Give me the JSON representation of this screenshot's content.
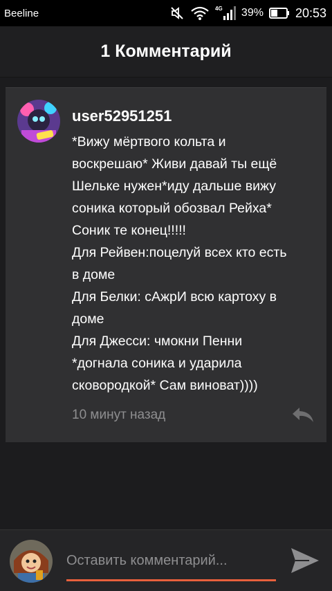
{
  "status_bar": {
    "carrier": "Beeline",
    "network": "4G",
    "battery_percent": "39%",
    "time": "20:53"
  },
  "header": {
    "title": "1 Комментарий"
  },
  "comment": {
    "username": "user52951251",
    "lines": [
      "*Вижу мёртвого кольта и",
      "воскрешаю* Живи давай ты ещё",
      "Шельке нужен*иду дальше вижу",
      "соника который обозвал Рейха*",
      "Соник те конец!!!!!",
      "Для Рейвен:поцелуй всех кто есть",
      "в доме",
      "Для Белки: сАжрИ всю картоху в",
      "доме",
      "Для Джесси: чмокни Пенни",
      "*догнала соника и ударила",
      "сковородкой* Сам виноват))))"
    ],
    "timestamp": "10 минут назад"
  },
  "input": {
    "placeholder": "Оставить комментарий..."
  },
  "colors": {
    "accent": "#e8603c",
    "card_bg": "#303032",
    "page_bg": "#1c1c1e",
    "muted_text": "#8e8e90"
  },
  "icons": [
    "mute-icon",
    "wifi-icon",
    "signal-icon",
    "battery-icon",
    "reply-icon",
    "send-icon"
  ]
}
